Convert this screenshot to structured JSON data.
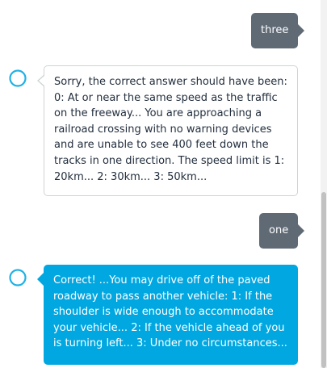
{
  "messages": [
    {
      "sender": "user",
      "text": "three"
    },
    {
      "sender": "alexa",
      "text": "Sorry, the correct answer should have been: 0: At or near the same speed as the traffic on the freeway... You are approaching a railroad crossing with no warning devices and are unable to see 400 feet down the tracks in one direction. The speed limit is 1: 20km... 2: 30km... 3: 50km..."
    },
    {
      "sender": "user",
      "text": "one"
    },
    {
      "sender": "alexa",
      "text": "Correct! ...You may drive off of the paved roadway to pass another vehicle: 1: If the shoulder is wide enough to accommodate your vehicle... 2: If the vehicle ahead of you is turning left... 3: Under no circumstances..."
    }
  ],
  "icons": {
    "alexa_avatar": "alexa-ring-icon"
  },
  "colors": {
    "user_bubble": "#5f6a75",
    "alexa_highlight_bubble": "#00a7e1",
    "alexa_plain_border": "#cfd3d6",
    "avatar_ring": "#1fb1e6"
  }
}
